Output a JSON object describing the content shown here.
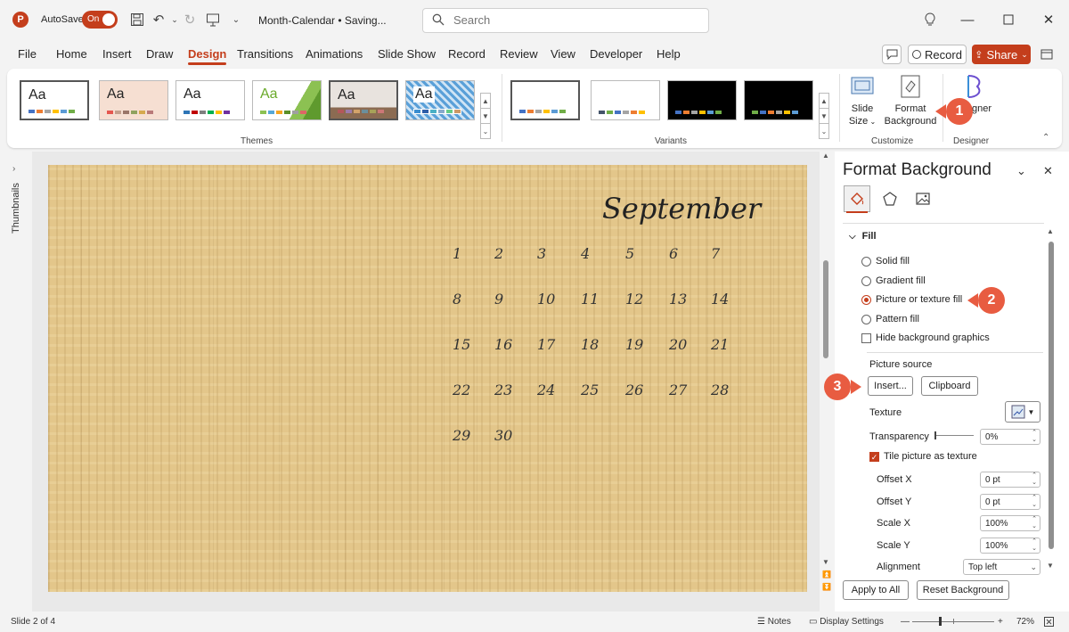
{
  "app": {
    "logo_letter": "P",
    "autosave_label": "AutoSave",
    "autosave_state": "On",
    "doc_title": "Month-Calendar • Saving...",
    "search_placeholder": "Search"
  },
  "tabs": [
    "File",
    "Home",
    "Insert",
    "Draw",
    "Design",
    "Transitions",
    "Animations",
    "Slide Show",
    "Record",
    "Review",
    "View",
    "Developer",
    "Help"
  ],
  "active_tab": "Design",
  "right_buttons": {
    "record": "Record",
    "share": "Share"
  },
  "ribbon": {
    "themes_label": "Themes",
    "variants_label": "Variants",
    "customize_label": "Customize",
    "designer_label": "Designer",
    "theme_sample_text": "Aa",
    "slide_size_line1": "Slide",
    "slide_size_line2": "Size",
    "format_bg_line1": "Format",
    "format_bg_line2": "Background",
    "designer_btn_fragment": "gner"
  },
  "callouts": [
    "1",
    "2",
    "3"
  ],
  "thumbnails_label": "Thumbnails",
  "slide": {
    "month": "September",
    "days": [
      "1",
      "2",
      "3",
      "4",
      "5",
      "6",
      "7",
      "8",
      "9",
      "10",
      "11",
      "12",
      "13",
      "14",
      "15",
      "16",
      "17",
      "18",
      "19",
      "20",
      "21",
      "22",
      "23",
      "24",
      "25",
      "26",
      "27",
      "28",
      "29",
      "30"
    ]
  },
  "pane": {
    "title": "Format Background",
    "section": "Fill",
    "fill_options": [
      {
        "label": "Solid fill",
        "selected": false
      },
      {
        "label": "Gradient fill",
        "selected": false
      },
      {
        "label": "Picture or texture fill",
        "selected": true
      },
      {
        "label": "Pattern fill",
        "selected": false
      }
    ],
    "hide_bg_label": "Hide background graphics",
    "picture_source_label": "Picture source",
    "insert_btn": "Insert...",
    "clipboard_btn": "Clipboard",
    "texture_label": "Texture",
    "transparency_label": "Transparency",
    "transparency_value": "0%",
    "tile_label": "Tile picture as texture",
    "offset_x_label": "Offset X",
    "offset_x_value": "0 pt",
    "offset_y_label": "Offset Y",
    "offset_y_value": "0 pt",
    "scale_x_label": "Scale X",
    "scale_x_value": "100%",
    "scale_y_label": "Scale Y",
    "scale_y_value": "100%",
    "alignment_label": "Alignment",
    "alignment_value": "Top left",
    "apply_all_btn": "Apply to All",
    "reset_btn": "Reset Background"
  },
  "status": {
    "slide_info": "Slide 2 of 4",
    "notes": "Notes",
    "display_settings": "Display Settings",
    "zoom": "72%"
  },
  "colors": {
    "accent": "#c43e1c",
    "callout": "#e85c41",
    "parchment": "#e3c68a"
  }
}
